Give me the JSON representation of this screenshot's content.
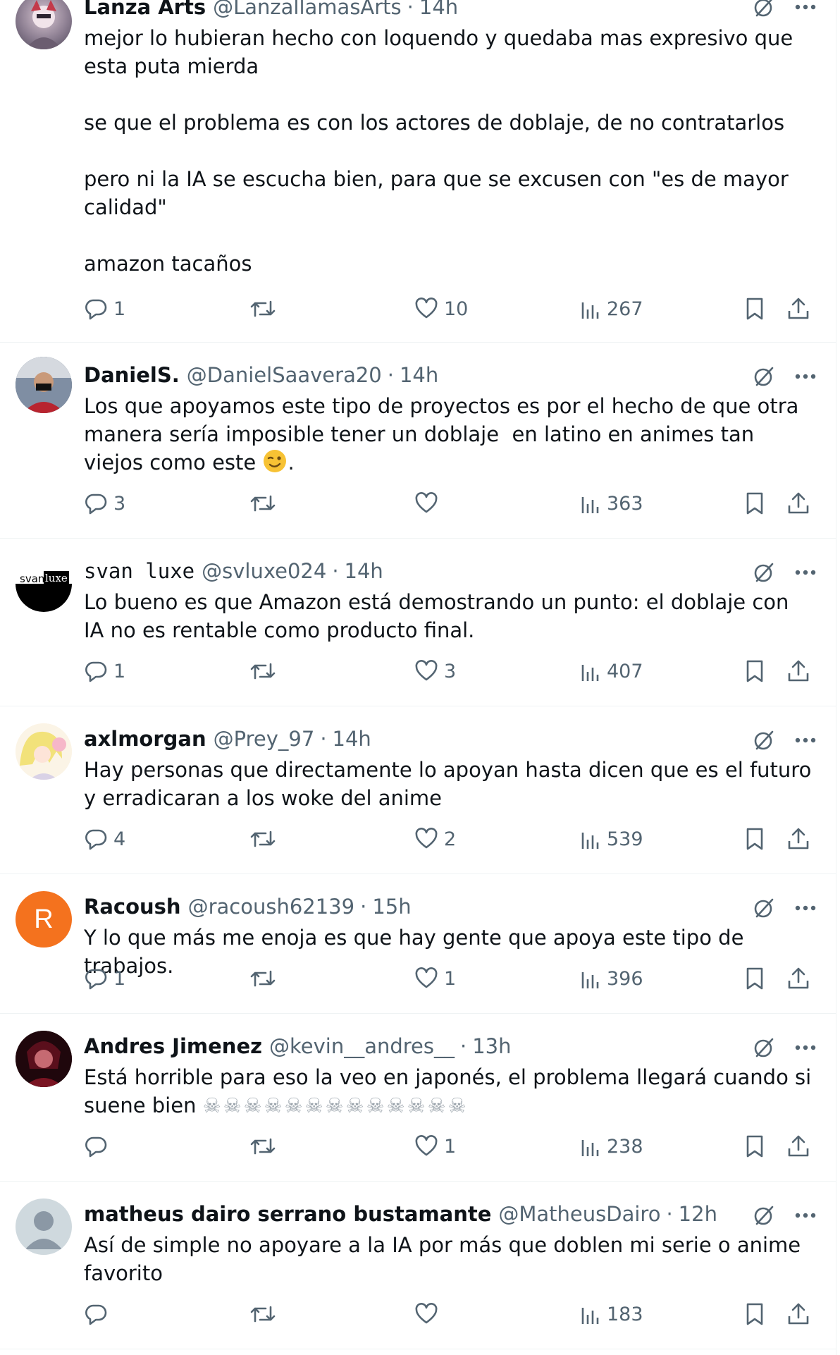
{
  "tweets": [
    {
      "name": "Lanza Arts",
      "handle": "@LanzallamasArts",
      "separator": "·",
      "time": "14h",
      "text": "mejor lo hubieran hecho con loquendo y quedaba mas expresivo que esta puta mierda\n\nse que el problema es con los actores de doblaje, de no contratarlos\n\npero ni la IA se escucha bien, para que se excusen con \"es de mayor calidad\"\n\namazon tacaños",
      "replies": "1",
      "retweets": "",
      "likes": "10",
      "views": "267"
    },
    {
      "name": "DanielS.",
      "handle": "@DanielSaavera20",
      "separator": "·",
      "time": "14h",
      "text": "Los que apoyamos este tipo de proyectos es por el hecho de que otra manera sería imposible tener un doblaje  en latino en animes tan viejos como este",
      "text_suffix": ".",
      "emoji": "winking-face",
      "replies": "3",
      "retweets": "",
      "likes": "",
      "views": "363"
    },
    {
      "name": "svan luxe",
      "handle": "@svluxe024",
      "separator": "·",
      "time": "14h",
      "avatar_text_1": "svan",
      "avatar_text_2": "luxe",
      "text": "Lo bueno es que Amazon está demostrando un punto: el doblaje con IA no es rentable como producto final.",
      "replies": "1",
      "retweets": "",
      "likes": "3",
      "views": "407"
    },
    {
      "name": "axlmorgan",
      "handle": "@Prey_97",
      "separator": "·",
      "time": "14h",
      "text": "Hay personas que directamente lo apoyan hasta dicen que es el futuro y erradicaran a los woke del anime",
      "replies": "4",
      "retweets": "",
      "likes": "2",
      "views": "539"
    },
    {
      "name": "Racoush",
      "handle": "@racoush62139",
      "separator": "·",
      "time": "15h",
      "avatar_letter": "R",
      "text": "Y lo que más me enoja es que hay gente que apoya este tipo de trabajos.",
      "replies": "1",
      "retweets": "",
      "likes": "1",
      "views": "396"
    },
    {
      "name": "Andres Jimenez",
      "handle": "@kevin__andres__",
      "separator": "·",
      "time": "13h",
      "text": "Está horrible para eso la veo en japonés, el problema llegará cuando si suene bien ",
      "emoji_row": "☠☠☠☠☠☠☠☠☠☠☠☠☠",
      "replies": "",
      "retweets": "",
      "likes": "1",
      "views": "238"
    },
    {
      "name": "matheus dairo serrano bustamante",
      "handle": "@MatheusDairo",
      "separator": "·",
      "time": "12h",
      "text": "Así de simple no apoyare a la IA por más que doblen mi serie o anime favorito",
      "replies": "",
      "retweets": "",
      "likes": "",
      "views": "183"
    }
  ],
  "colors": {
    "text": "#0f1419",
    "secondary": "#536471",
    "divider": "#eff3f4",
    "racoush_avatar": "#f4721e"
  },
  "icons": [
    "reply-icon",
    "retweet-icon",
    "like-icon",
    "views-icon",
    "bookmark-icon",
    "share-icon",
    "grok-icon",
    "more-icon"
  ]
}
